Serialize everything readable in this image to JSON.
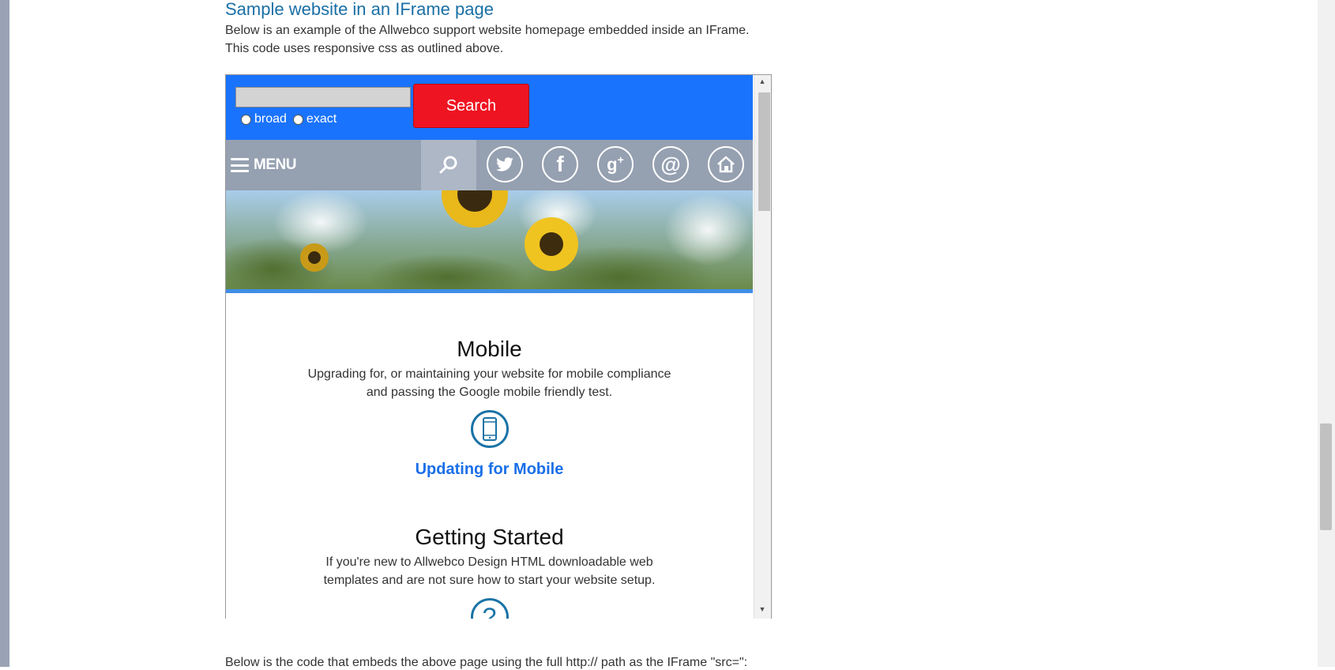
{
  "page": {
    "heading": "Sample website in an IFrame page",
    "intro_line1": "Below is an example of the Allwebco support website homepage embedded inside an IFrame.",
    "intro_line2": "This code uses responsive css as outlined above.",
    "below_text": "Below is the code that embeds the above page using the full http:// path as the IFrame \"src=\":"
  },
  "iframe": {
    "search": {
      "input_value": "",
      "radio_broad": "broad",
      "radio_exact": "exact",
      "button_label": "Search"
    },
    "nav": {
      "menu_label": "MENU",
      "icons": [
        "search-icon",
        "twitter-icon",
        "facebook-icon",
        "google-plus-icon",
        "email-icon",
        "home-icon"
      ]
    },
    "sections": [
      {
        "title": "Mobile",
        "text_line1": "Upgrading for, or maintaining your website for mobile compliance",
        "text_line2": "and passing the Google mobile friendly test.",
        "icon": "mobile-phone-icon",
        "link": "Updating for Mobile"
      },
      {
        "title": "Getting Started",
        "text_line1": "If you're new to Allwebco Design HTML downloadable web",
        "text_line2": "templates and are not sure how to start your website setup.",
        "icon": "question-mark-icon"
      }
    ]
  },
  "colors": {
    "heading": "#1a6fa6",
    "topbar": "#1a73fc",
    "search_button": "#ef1422",
    "navbar": "#95a0b1",
    "link": "#1a6fe8"
  }
}
